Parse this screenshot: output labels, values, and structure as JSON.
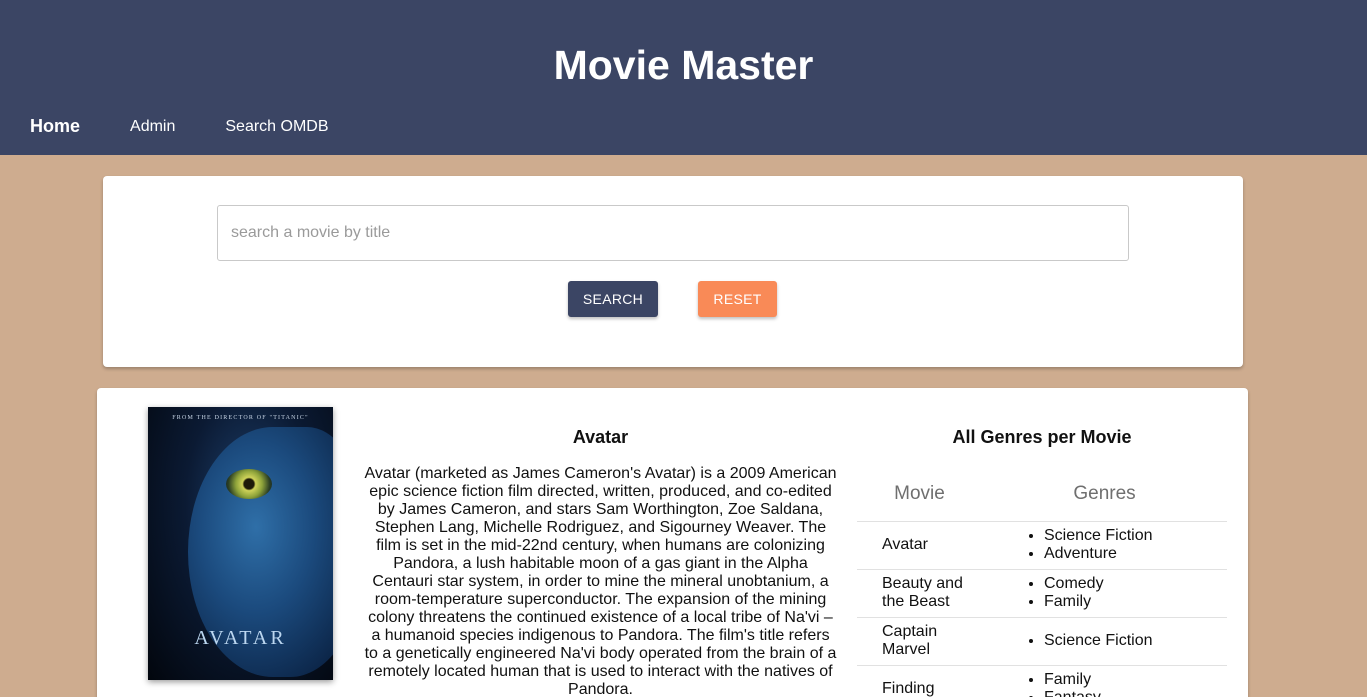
{
  "header": {
    "title": "Movie Master",
    "nav": [
      {
        "label": "Home",
        "active": true
      },
      {
        "label": "Admin",
        "active": false
      },
      {
        "label": "Search OMDB",
        "active": false
      }
    ]
  },
  "search": {
    "placeholder": "search a movie by title",
    "value": "",
    "search_label": "SEARCH",
    "reset_label": "RESET"
  },
  "movie": {
    "poster_tagline": "FROM THE DIRECTOR OF \"TITANIC\"",
    "poster_name": "AVATAR",
    "title": "Avatar",
    "description": "Avatar (marketed as James Cameron's Avatar) is a 2009 American epic science fiction film directed, written, produced, and co-edited by James Cameron, and stars Sam Worthington, Zoe Saldana, Stephen Lang, Michelle Rodriguez, and Sigourney Weaver. The film is set in the mid-22nd century, when humans are colonizing Pandora, a lush habitable moon of a gas giant in the Alpha Centauri star system, in order to mine the mineral unobtanium, a room-temperature superconductor. The expansion of the mining colony threatens the continued existence of a local tribe of Na'vi – a humanoid species indigenous to Pandora. The film's title refers to a genetically engineered Na'vi body operated from the brain of a remotely located human that is used to interact with the natives of Pandora."
  },
  "genres": {
    "title": "All Genres per Movie",
    "columns": [
      "Movie",
      "Genres"
    ],
    "rows": [
      {
        "movie": "Avatar",
        "genres": [
          "Science Fiction",
          "Adventure"
        ]
      },
      {
        "movie": "Beauty and the Beast",
        "genres": [
          "Comedy",
          "Family"
        ]
      },
      {
        "movie": "Captain Marvel",
        "genres": [
          "Science Fiction"
        ]
      },
      {
        "movie": "Finding",
        "genres": [
          "Family",
          "Fantasy"
        ]
      }
    ]
  },
  "colors": {
    "header_bg": "#3b4564",
    "page_bg": "#ceac8f",
    "reset_button": "#f98a57"
  }
}
